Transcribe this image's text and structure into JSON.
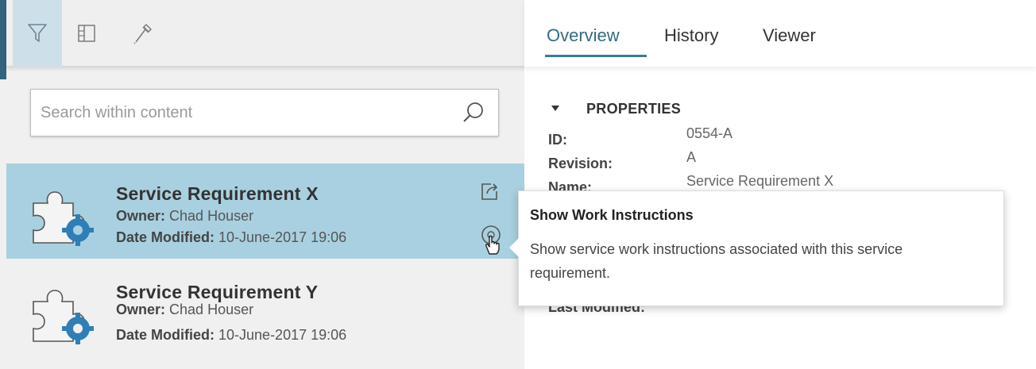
{
  "toolbar": {
    "tools": [
      {
        "icon": "filter-icon",
        "active": true
      },
      {
        "icon": "panel-layout-icon",
        "active": false
      },
      {
        "icon": "eyedropper-icon",
        "active": false
      }
    ]
  },
  "search": {
    "placeholder": "Search within content",
    "value": ""
  },
  "items": [
    {
      "title": "Service Requirement X",
      "owner_label": "Owner:",
      "owner": "Chad Houser",
      "modified_label": "Date Modified:",
      "modified": "10-June-2017 19:06",
      "selected": true
    },
    {
      "title": "Service Requirement Y",
      "owner_label": "Owner:",
      "owner": "Chad Houser",
      "modified_label": "Date Modified:",
      "modified": "10-June-2017 19:06",
      "selected": false
    }
  ],
  "tabs": [
    {
      "label": "Overview",
      "active": true
    },
    {
      "label": "History",
      "active": false
    },
    {
      "label": "Viewer",
      "active": false
    }
  ],
  "properties": {
    "heading": "PROPERTIES",
    "rows": [
      {
        "label": "ID:",
        "value": "0554-A"
      },
      {
        "label": "Revision:",
        "value": "A"
      },
      {
        "label": "Name:",
        "value": "Service Requirement X"
      },
      {
        "label": "Last Modified:",
        "value": ""
      }
    ]
  },
  "tooltip": {
    "title": "Show Work Instructions",
    "body": "Show service work instructions associated with this service requirement."
  },
  "colors": {
    "selected_row": "#a9d0e0",
    "active_tool": "#cde0ea",
    "accent": "#3d7a98",
    "gear": "#2f7fb6"
  }
}
